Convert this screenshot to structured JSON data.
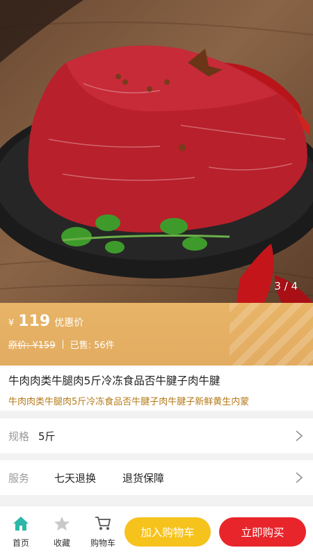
{
  "gallery": {
    "indicator": "3 / 4"
  },
  "price": {
    "currency": "¥",
    "value": "119",
    "tag": "优惠价",
    "original": "原价: ¥159",
    "sold": "已售: 56件"
  },
  "product": {
    "title": "牛肉肉类牛腿肉5斤冷冻食品否牛腱子肉牛腱",
    "subtitle": "牛肉肉类牛腿肉5斤冷冻食品否牛腱子肉牛腱子新鲜黄生内蒙"
  },
  "spec": {
    "label": "规格",
    "value": "5斤"
  },
  "service": {
    "label": "服务",
    "items": [
      "七天退换",
      "退货保障"
    ]
  },
  "tabbar": {
    "home": "首页",
    "favorite": "收藏",
    "cart": "购物车",
    "add_to_cart": "加入购物车",
    "buy_now": "立即购买"
  },
  "colors": {
    "price_band": "#e2ac62",
    "subtitle": "#b47a18",
    "add_to_cart_btn": "#f6c21c",
    "buy_now_btn": "#e8252b",
    "home_icon_active": "#2db7a8"
  },
  "icons": [
    "home-icon",
    "star-icon",
    "cart-icon",
    "chevron-right-icon"
  ]
}
